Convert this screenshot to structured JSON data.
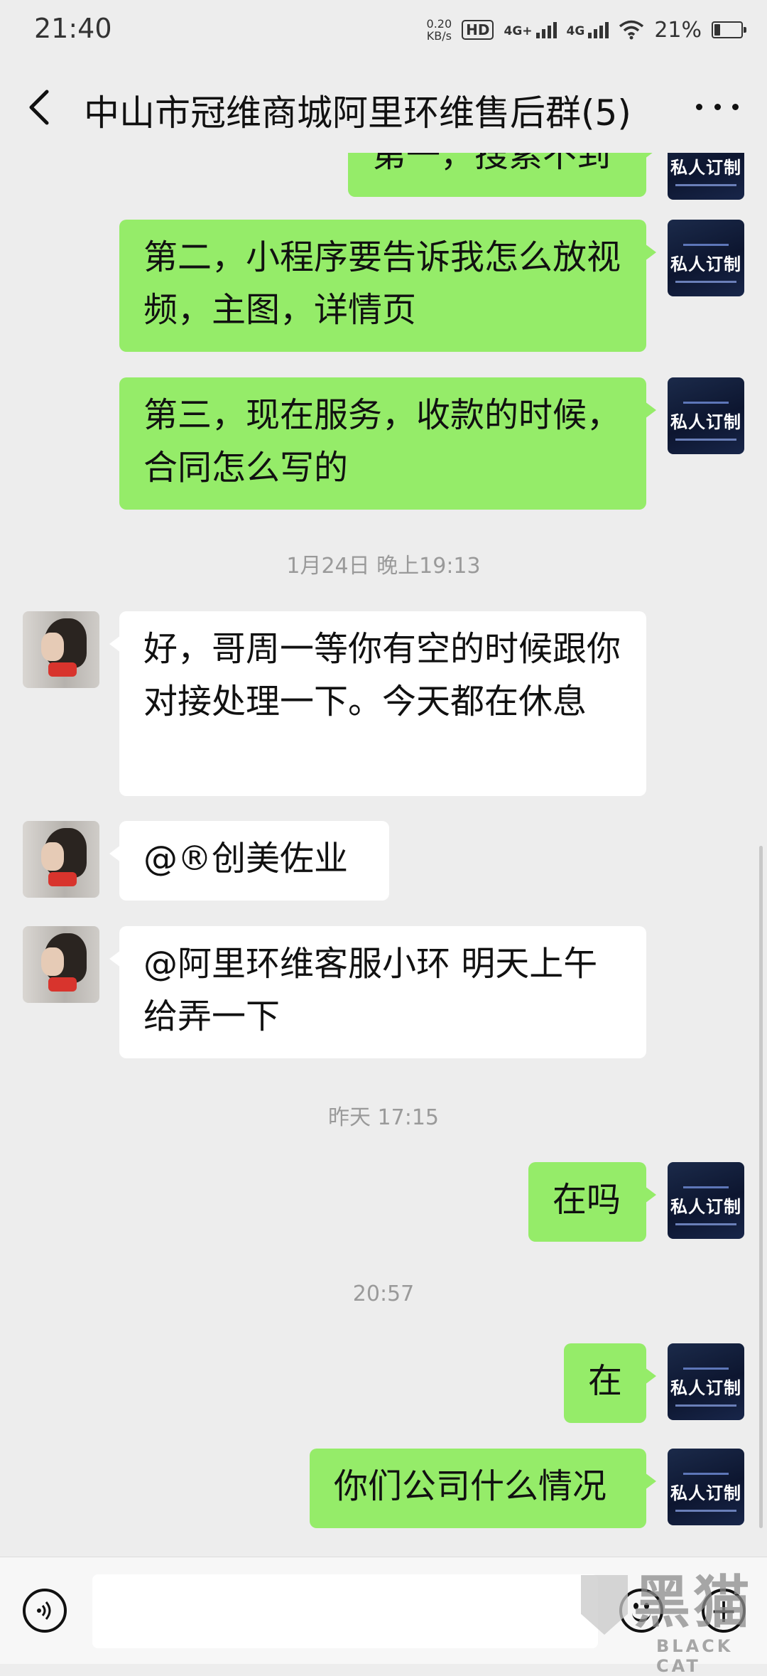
{
  "status_bar": {
    "time": "21:40",
    "net_speed_value": "0.20",
    "net_speed_unit": "KB/s",
    "hd_label": "HD",
    "sim1_label": "4G+",
    "sim2_label": "4G",
    "battery_percent": "21%",
    "battery_level": 0.21
  },
  "nav": {
    "title": "中山市冠维商城阿里环维售后群(5)",
    "back_icon": "chevron-left-icon",
    "more_icon": "more-dots-icon"
  },
  "avatars": {
    "me_text": "私人订制"
  },
  "messages": {
    "m0": "第一，搜索不到",
    "m1": "第二，小程序要告诉我怎么放视频，主图，详情页",
    "m2": "第三，现在服务，收款的时候，合同怎么写的",
    "t1": "1月24日 晚上19:13",
    "m3": "好，哥周一等你有空的时候跟你对接处理一下。今天都在休息",
    "m4": "@®创美佐业",
    "m5": "@阿里环维客服小环  明天上午给弄一下",
    "t2": "昨天 17:15",
    "m6": "在吗",
    "t3": "20:57",
    "m7": "在",
    "m8": "你们公司什么情况"
  },
  "input_bar": {
    "input_value": "",
    "voice_icon": "voice-icon",
    "emoji_icon": "emoji-icon",
    "plus_icon": "plus-icon"
  },
  "watermark": {
    "cn": "黑猫",
    "en": "BLACK CAT"
  },
  "colors": {
    "background": "#ededed",
    "bubble_me": "#95ec69",
    "bubble_them": "#ffffff"
  }
}
